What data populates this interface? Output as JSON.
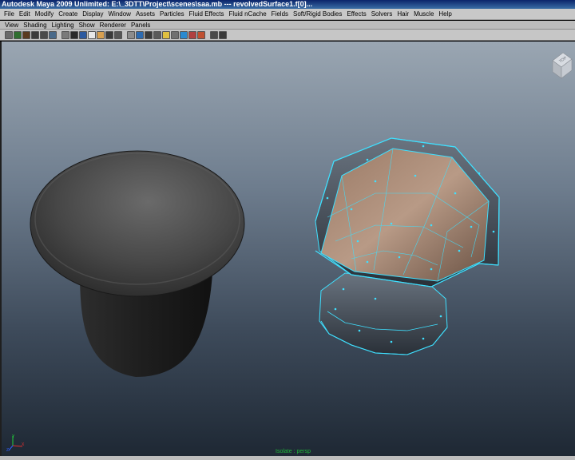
{
  "window": {
    "title": "Autodesk Maya 2009 Unlimited: E:\\_3DTT\\Project\\scenes\\saa.mb  ---  revolvedSurface1.f[0]..."
  },
  "menubar": {
    "items": [
      "File",
      "Edit",
      "Modify",
      "Create",
      "Display",
      "Window",
      "Assets",
      "Particles",
      "Fluid Effects",
      "Fluid nCache",
      "Fields",
      "Soft/Rigid Bodies",
      "Effects",
      "Solvers",
      "Hair",
      "Muscle",
      "Help"
    ]
  },
  "panel_menu": {
    "items": [
      "View",
      "Shading",
      "Lighting",
      "Show",
      "Renderer",
      "Panels"
    ]
  },
  "panel_toolbar": {
    "icons": [
      {
        "name": "select-camera-icon",
        "color": "#6a6a6a"
      },
      {
        "name": "camera-attributes-icon",
        "color": "#2f6e2f"
      },
      {
        "name": "bookmark-icon",
        "color": "#5a3a20"
      },
      {
        "name": "image-plane-icon",
        "color": "#3b3b3b"
      },
      {
        "name": "two-d-pan-zoom-icon",
        "color": "#4a4a4a"
      },
      {
        "name": "grease-pencil-icon",
        "color": "#4a6a8a"
      },
      {
        "name": "grid-icon",
        "color": "#7a7a7a"
      },
      {
        "name": "film-gate-icon",
        "color": "#2a2a2a"
      },
      {
        "name": "resolution-gate-icon",
        "color": "#2c5aa0"
      },
      {
        "name": "gate-mask-icon",
        "color": "#e8e8e8"
      },
      {
        "name": "field-chart-icon",
        "color": "#d8a050"
      },
      {
        "name": "safe-action-icon",
        "color": "#3a3a3a"
      },
      {
        "name": "safe-title-icon",
        "color": "#555555"
      },
      {
        "name": "wireframe-icon",
        "color": "#8c8c8c"
      },
      {
        "name": "smooth-shade-icon",
        "color": "#2c6ab0"
      },
      {
        "name": "wireframe-on-shaded-icon",
        "color": "#3a3a3a"
      },
      {
        "name": "textured-icon",
        "color": "#5a5a5a"
      },
      {
        "name": "use-all-lights-icon",
        "color": "#e0c040"
      },
      {
        "name": "shadows-icon",
        "color": "#707070"
      },
      {
        "name": "xray-icon",
        "color": "#2a8ad0"
      },
      {
        "name": "xray-joints-icon",
        "color": "#b04040"
      },
      {
        "name": "isolate-select-icon",
        "color": "#c05030"
      },
      {
        "name": "high-quality-icon",
        "color": "#4a4a4a"
      },
      {
        "name": "two-sided-lighting-icon",
        "color": "#3a3a3a"
      }
    ]
  },
  "viewport": {
    "background_top": "#9aa6b2",
    "background_bottom": "#1e2834",
    "camera_label": "Isolate : persp",
    "wire_color": "#3fe0ff",
    "interior_color": "#8a6a58",
    "viewcube_face": "TOP",
    "axis_labels": [
      "Y",
      "X",
      "Z"
    ]
  }
}
